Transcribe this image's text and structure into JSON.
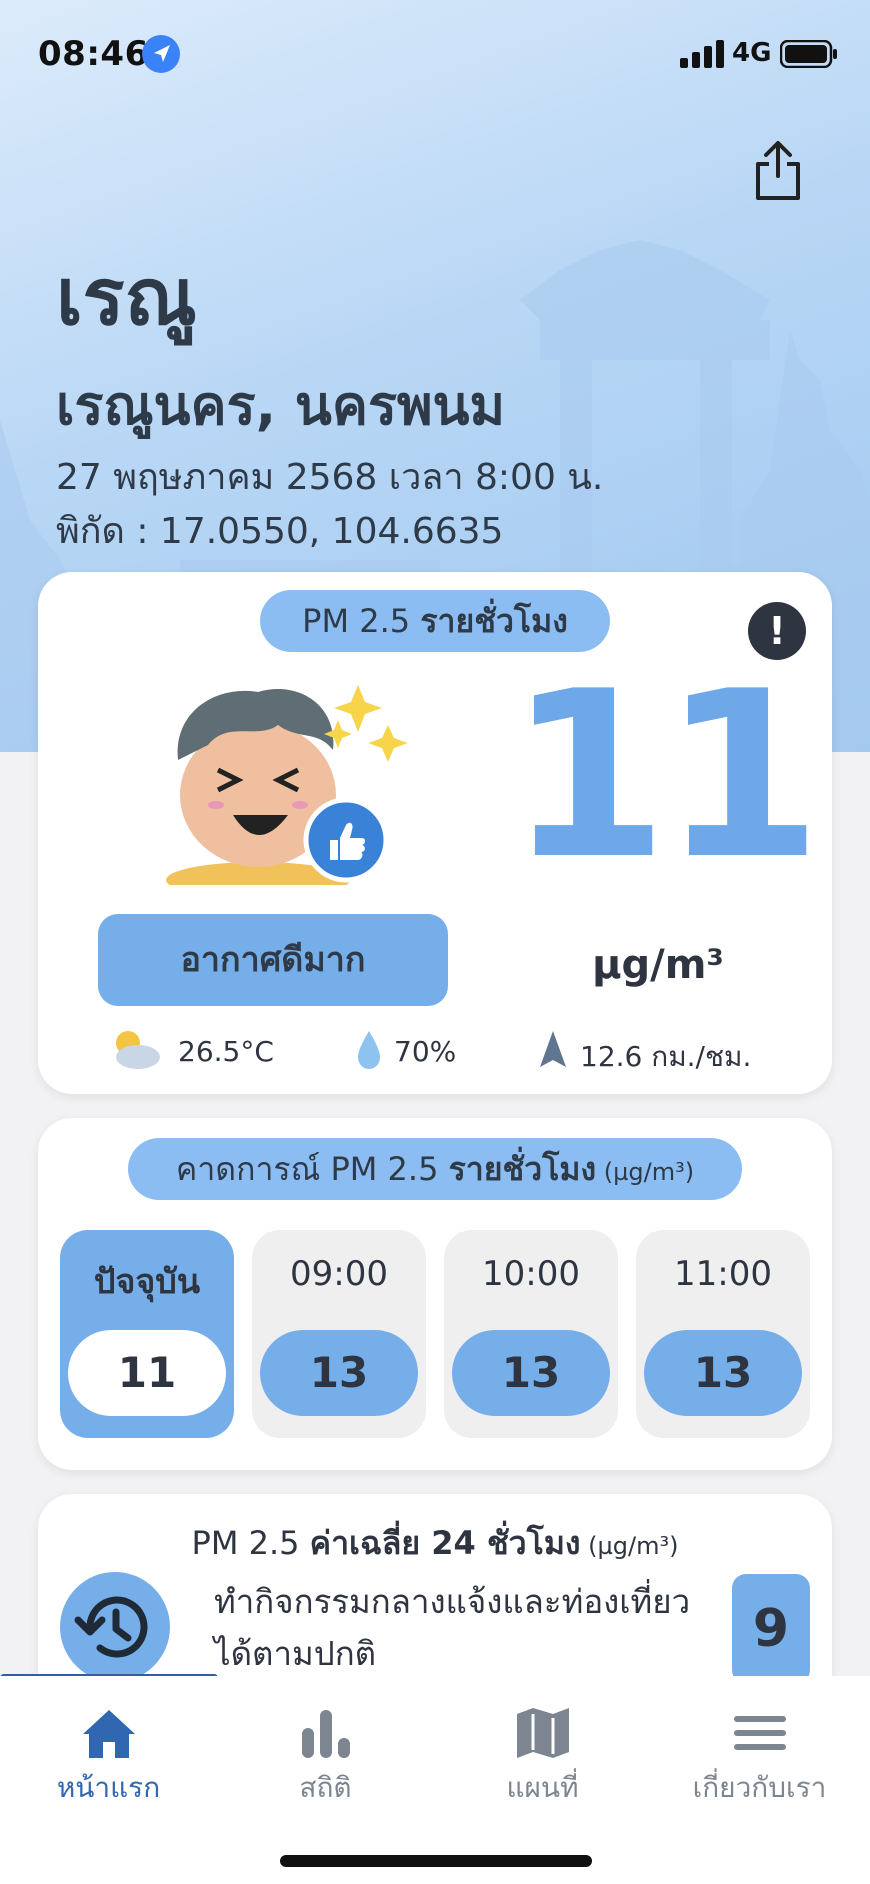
{
  "status_bar": {
    "time": "08:46",
    "network": "4G",
    "icons": [
      "location-arrow-icon",
      "signal-bars-icon",
      "battery-icon"
    ]
  },
  "header": {
    "title": "เรณู",
    "subtitle": "เรณูนคร, นครพนม",
    "datetime": "27 พฤษภาคม 2568  เวลา 8:00 น.",
    "coords": "พิกัด : 17.0550, 104.6635",
    "share_icon": "share-icon"
  },
  "current": {
    "pill_prefix": "PM 2.5 ",
    "pill_bold": "รายชั่วโมง",
    "info_label": "!",
    "pm_value": "11",
    "unit": "µg/m³",
    "quality_label": "อากาศดีมาก",
    "temperature": "26.5°C",
    "humidity": "70%",
    "wind": "12.6 กม./ชม.",
    "color_accent": "#6fa8e8"
  },
  "forecast": {
    "pill_prefix": "คาดการณ์ PM 2.5 ",
    "pill_bold": "รายชั่วโมง",
    "pill_unit": " (µg/m³)",
    "slots": [
      {
        "label": "ปัจจุบัน",
        "value": "11"
      },
      {
        "label": "09:00",
        "value": "13"
      },
      {
        "label": "10:00",
        "value": "13"
      },
      {
        "label": "11:00",
        "value": "13"
      }
    ]
  },
  "average": {
    "title_prefix": "PM 2.5 ",
    "title_bold": "ค่าเฉลี่ย 24 ชั่วโมง",
    "title_unit": " (µg/m³)",
    "advice": "ทำกิจกรรมกลางแจ้งและท่องเที่ยวได้ตามปกติ",
    "value": "9"
  },
  "tabbar": {
    "tabs": [
      {
        "label": "หน้าแรก",
        "icon": "home-icon"
      },
      {
        "label": "สถิติ",
        "icon": "bar-chart-icon"
      },
      {
        "label": "แผนที่",
        "icon": "map-icon"
      },
      {
        "label": "เกี่ยวกับเรา",
        "icon": "menu-icon"
      }
    ],
    "active_color": "#3166b0"
  }
}
